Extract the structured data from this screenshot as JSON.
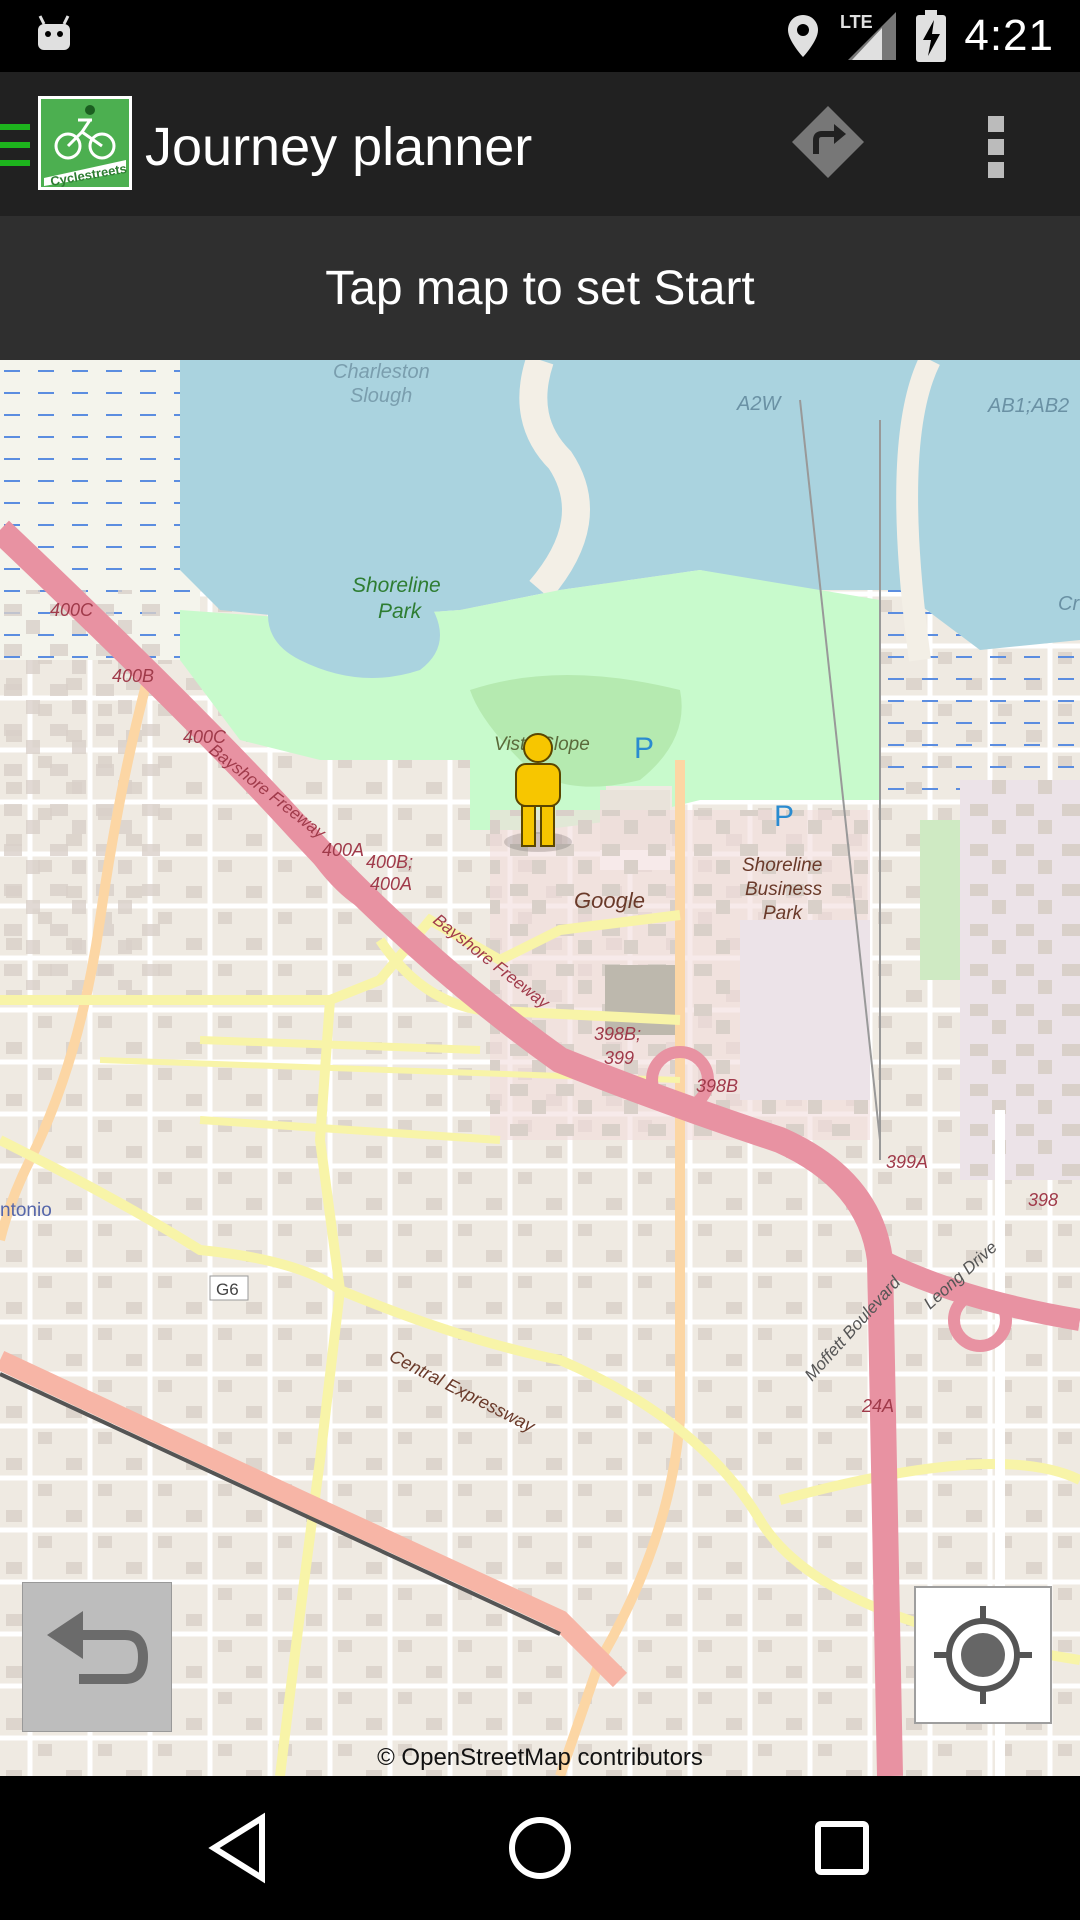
{
  "status_bar": {
    "time": "4:21",
    "network": "LTE",
    "icons": [
      "android-debug-icon",
      "location-icon",
      "lte-signal-icon",
      "battery-charging-icon"
    ]
  },
  "action_bar": {
    "logo_text": "Cyclestreets",
    "title": "Journey planner",
    "icons": [
      "drawer-menu-icon",
      "directions-icon",
      "overflow-menu-icon"
    ]
  },
  "prompt": {
    "text": "Tap map to set Start"
  },
  "map": {
    "labels": {
      "charleston": "Charleston",
      "slough": "Slough",
      "a2w": "A2W",
      "ab1": "AB1;AB2",
      "cr": "Cr",
      "shoreline": "Shoreline",
      "park": "Park",
      "j400c_top": "400C",
      "j400b": "400B",
      "j400c": "400C",
      "bayshore1": "Bayshore Freeway",
      "j400a": "400A",
      "j400b400a_1": "400B;",
      "j400b400a_2": "400A",
      "vista": "Vista Slope",
      "parking1": "P",
      "parking2": "P",
      "sbp1": "Shoreline",
      "sbp2": "Business",
      "sbp3": "Park",
      "google": "Google",
      "bayshore2": "Bayshore Freeway",
      "j398b399_1": "398B;",
      "j398b399_2": "399",
      "j398b": "398B",
      "j399a": "399A",
      "j398": "398",
      "antonio": "ntonio",
      "leong": "Leong Drive",
      "moffett": "Moffett Boulevard",
      "g6": "G6",
      "central": "Central Expressway",
      "j24a": "24A"
    },
    "attribution": "© OpenStreetMap contributors",
    "colors": {
      "water": "#aad3df",
      "park": "#c8facc",
      "motorway": "#e892a2",
      "primary": "#f8f4a8",
      "trunk": "#fcd6a4",
      "land": "#f0ebe3",
      "building": "#d9d0c9"
    }
  },
  "controls": {
    "icons": [
      "undo-icon",
      "my-location-icon"
    ]
  },
  "nav_bar": {
    "icons": [
      "back-icon",
      "home-icon",
      "recents-icon"
    ]
  }
}
